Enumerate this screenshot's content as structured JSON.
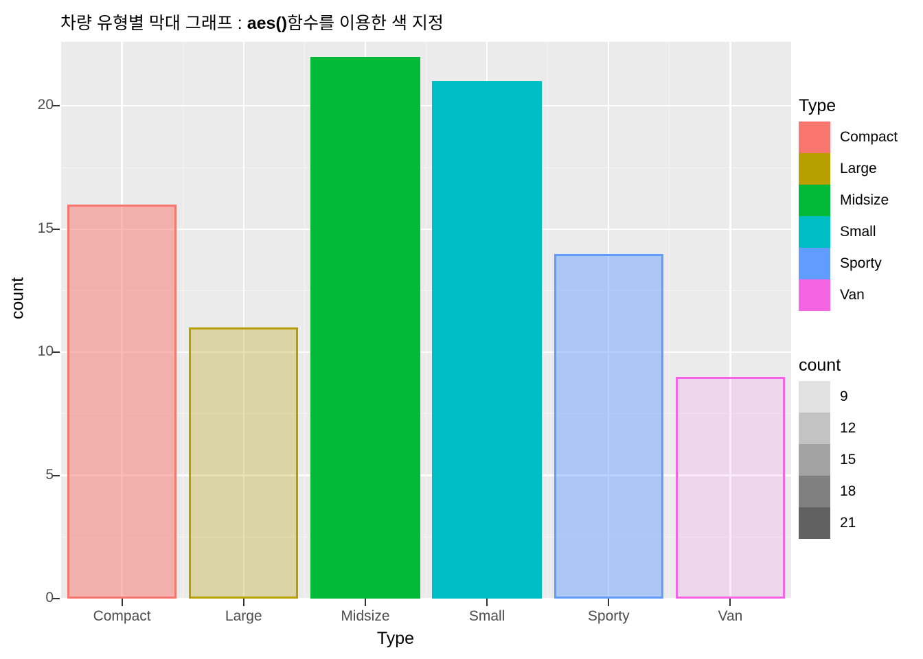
{
  "title": {
    "prefix": "차량 유형별 막대 그래프 : ",
    "code": "aes()",
    "suffix": "함수를 이용한 색 지정"
  },
  "axes": {
    "x_title": "Type",
    "y_title": "count",
    "y_ticks": [
      "0",
      "5",
      "10",
      "15",
      "20"
    ],
    "x_ticks": [
      "Compact",
      "Large",
      "Midsize",
      "Small",
      "Sporty",
      "Van"
    ]
  },
  "legends": {
    "type": {
      "title": "Type",
      "items": [
        {
          "label": "Compact",
          "color": "#f8766d"
        },
        {
          "label": "Large",
          "color": "#b79f00"
        },
        {
          "label": "Midsize",
          "color": "#00ba38"
        },
        {
          "label": "Small",
          "color": "#00bfc4"
        },
        {
          "label": "Sporty",
          "color": "#619cff"
        },
        {
          "label": "Van",
          "color": "#f564e3"
        }
      ]
    },
    "count": {
      "title": "count",
      "items": [
        {
          "label": "9",
          "color": "#e1e1e1"
        },
        {
          "label": "12",
          "color": "#c3c3c3"
        },
        {
          "label": "15",
          "color": "#a2a2a2"
        },
        {
          "label": "18",
          "color": "#808080"
        },
        {
          "label": "21",
          "color": "#616161"
        }
      ]
    }
  },
  "chart_data": {
    "type": "bar",
    "title": "차량 유형별 막대 그래프 : aes()함수를 이용한 색 지정",
    "xlabel": "Type",
    "ylabel": "count",
    "categories": [
      "Compact",
      "Large",
      "Midsize",
      "Small",
      "Sporty",
      "Van"
    ],
    "values": [
      16,
      11,
      22,
      21,
      14,
      9
    ],
    "ylim": [
      0,
      22.6
    ],
    "y_ticks": [
      0,
      5,
      10,
      15,
      20
    ],
    "y_minor_ticks": [
      2.5,
      7.5,
      12.5,
      17.5
    ],
    "grid": true,
    "legend_position": "right",
    "panel_background": "#ebebeb",
    "bars": [
      {
        "category": "Compact",
        "value": 16,
        "fill": "#f8766d",
        "border": "#f8766d",
        "fill_opacity": 0.5
      },
      {
        "category": "Large",
        "value": 11,
        "fill": "#b79f00",
        "border": "#b79f00",
        "fill_opacity": 0.3
      },
      {
        "category": "Midsize",
        "value": 22,
        "fill": "#00ba38",
        "border": "#00ba38",
        "fill_opacity": 1.0
      },
      {
        "category": "Small",
        "value": 21,
        "fill": "#00bfc4",
        "border": "#00bfc4",
        "fill_opacity": 1.0
      },
      {
        "category": "Sporty",
        "value": 14,
        "fill": "#619cff",
        "border": "#619cff",
        "fill_opacity": 0.45
      },
      {
        "category": "Van",
        "value": 9,
        "fill": "#f564e3",
        "border": "#f564e3",
        "fill_opacity": 0.15
      }
    ]
  }
}
